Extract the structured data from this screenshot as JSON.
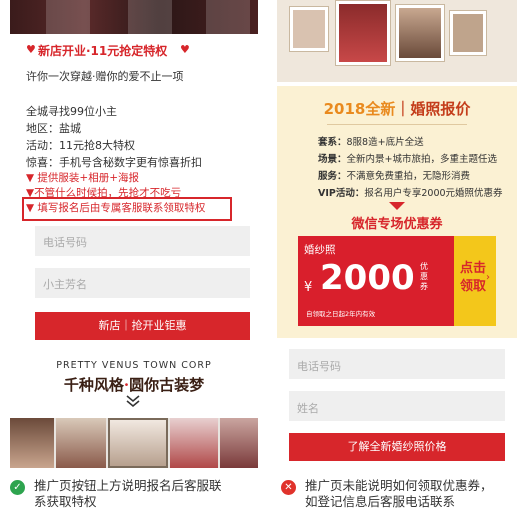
{
  "left": {
    "headline": "新店开业·11元抢定特权",
    "subheadline": "许你一次穿越·赠你的爱不止一项",
    "info_lines": [
      "全城寻找99位小主",
      "地区：盐城",
      "活动：11元抢8大特权",
      "惊喜：手机号含秘数字更有惊喜折扣"
    ],
    "red_lines": [
      "▼ 提供服装+相册+海报",
      "▼不管什么时候拍，先抢才不吃亏",
      "▼ 填写报名后由专属客服联系领取特权"
    ],
    "phone_placeholder": "电话号码",
    "name_placeholder": "小主芳名",
    "submit_label": "新店｜抢开业钜惠",
    "corp_name": "PRETTY VENUS TOWN CORP",
    "slogan_a": "千种风格",
    "slogan_dot": "·",
    "slogan_b": "圆你古装梦"
  },
  "right": {
    "title_year": "2018全新",
    "title_sep": "｜",
    "title_rest": "婚照报价",
    "rows": [
      {
        "label": "套系：",
        "text": "8服8造+底片全送"
      },
      {
        "label": "场景：",
        "text": "全新内景+城市旅拍，多重主题任选"
      },
      {
        "label": "服务：",
        "text": "不满意免费重拍，无隐形消费"
      },
      {
        "label": "VIP活动：",
        "text": "报名用户专享2000元婚照优惠券"
      }
    ],
    "coupon_title": "微信专场优惠券",
    "coupon": {
      "kind": "婚纱照",
      "currency": "¥",
      "amount": "2000",
      "unit": "优惠券",
      "note": "自领取之日起2年内有效",
      "cta": "点击领取",
      "arrow": "›"
    },
    "phone_placeholder": "电话号码",
    "name_placeholder": "姓名",
    "submit_label": "了解全新婚纱照价格"
  },
  "captions": {
    "good": {
      "icon": "check-icon",
      "color": "#2ea44f",
      "lines": [
        "推广页按钮上方说明报名后客服联",
        "系获取特权"
      ]
    },
    "bad": {
      "icon": "cross-icon",
      "color": "#e0322b",
      "lines": [
        "推广页未能说明如何领取优惠券，",
        "如登记信息后客服电话联系"
      ]
    }
  },
  "colors": {
    "accent_red": "#d7262b",
    "coupon_yellow": "#f3c71b",
    "card_bg": "#fbf1d3"
  }
}
